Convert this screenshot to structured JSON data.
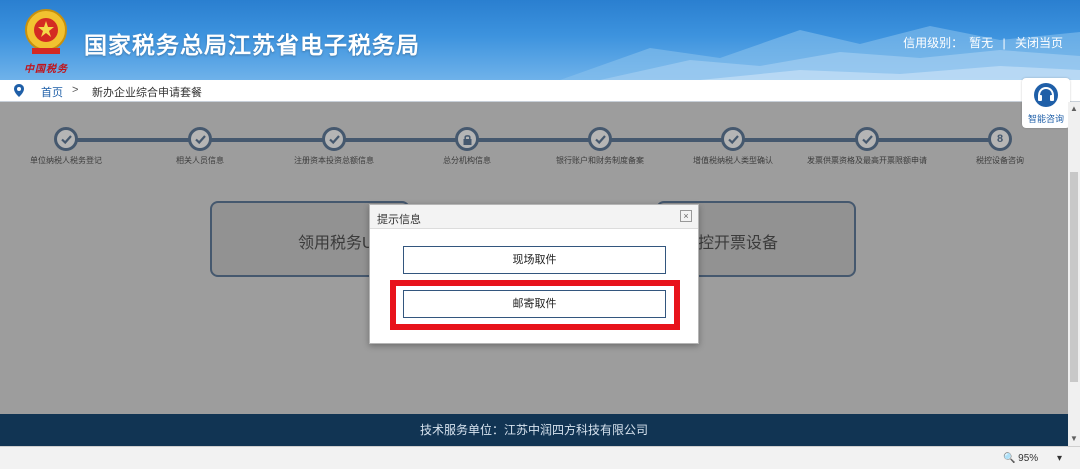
{
  "header": {
    "title": "国家税务总局江苏省电子税务局",
    "brand_script": "中国税务",
    "credit_label": "信用级别：",
    "credit_value": "暂无",
    "divider": "|",
    "close_page": "关闭当页"
  },
  "breadcrumb": {
    "home": "首页",
    "separator": ">",
    "current": "新办企业综合申请套餐"
  },
  "steps": [
    {
      "label": "单位纳税人税务登记",
      "state": "done"
    },
    {
      "label": "相关人员信息",
      "state": "done"
    },
    {
      "label": "注册资本投资总额信息",
      "state": "done"
    },
    {
      "label": "总分机构信息",
      "state": "locked"
    },
    {
      "label": "银行账户和财务制度备案",
      "state": "done"
    },
    {
      "label": "增值税纳税人类型确认",
      "state": "done"
    },
    {
      "label": "发票供票资格及最高开票限额申请",
      "state": "done"
    },
    {
      "label": "税控设备咨询",
      "state": "current",
      "number": "8"
    }
  ],
  "cards": {
    "left": "领用税务U",
    "right": "控开票设备"
  },
  "side_widget": {
    "label": "智能咨询"
  },
  "modal": {
    "title": "提示信息",
    "close": "×",
    "option_onsite": "现场取件",
    "option_mail": "邮寄取件"
  },
  "footer": {
    "text": "技术服务单位：江苏中润四方科技有限公司"
  },
  "statusbar": {
    "zoom": "95%",
    "zoom_dropdown": "▾"
  },
  "colors": {
    "header_blue": "#2a7fd0",
    "step_navy": "#33567e",
    "footer_navy": "#113453",
    "highlight_red": "#e8131b"
  }
}
